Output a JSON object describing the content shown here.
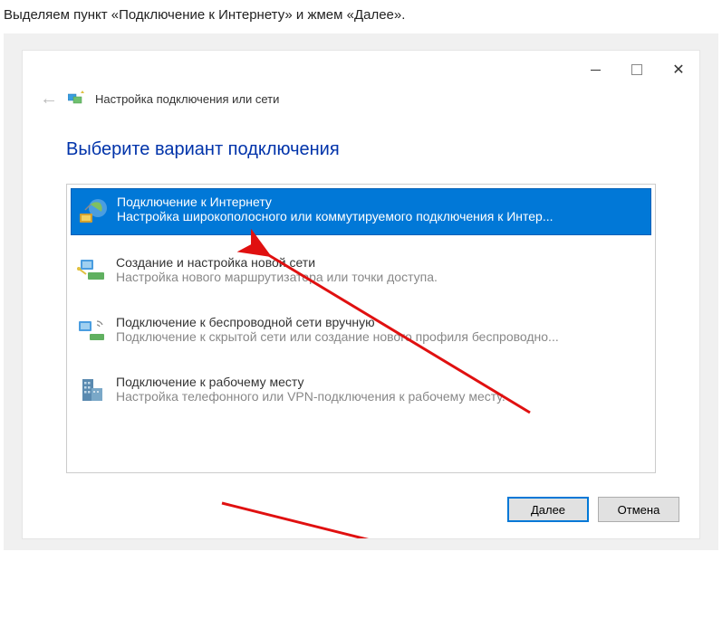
{
  "caption": "Выделяем пункт «Подключение к Интернету» и жмем «Далее».",
  "header": {
    "title": "Настройка подключения или сети"
  },
  "heading": "Выберите вариант подключения",
  "options": [
    {
      "title": "Подключение к Интернету",
      "desc": "Настройка широкополосного или коммутируемого подключения к Интер...",
      "selected": true
    },
    {
      "title": "Создание и настройка новой сети",
      "desc": "Настройка нового маршрутизатора или точки доступа."
    },
    {
      "title": "Подключение к беспроводной сети вручную",
      "desc": "Подключение к скрытой сети или создание нового профиля беспроводно..."
    },
    {
      "title": "Подключение к рабочему месту",
      "desc": "Настройка телефонного или VPN-подключения к рабочему месту."
    }
  ],
  "footer": {
    "next": "Далее",
    "cancel": "Отмена"
  }
}
